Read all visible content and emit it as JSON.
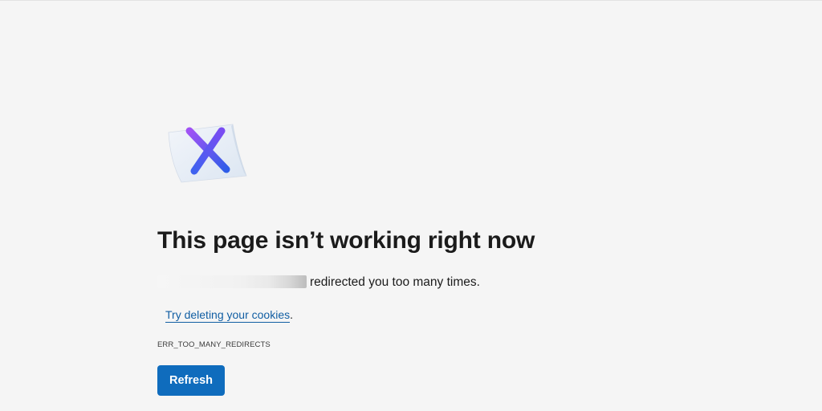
{
  "error_page": {
    "icon": "error-x-icon",
    "title": "This page isn’t working right now",
    "message_suffix": "redirected you too many times.",
    "suggestion_link": "Try deleting your cookies",
    "suggestion_suffix": ".",
    "error_code": "ERR_TOO_MANY_REDIRECTS",
    "refresh_label": "Refresh"
  },
  "colors": {
    "background": "#f5f5f5",
    "primary_button": "#0f6cbd",
    "link": "#115ea3",
    "icon_gradient_start": "#8a4dff",
    "icon_gradient_end": "#3a5bf0"
  }
}
